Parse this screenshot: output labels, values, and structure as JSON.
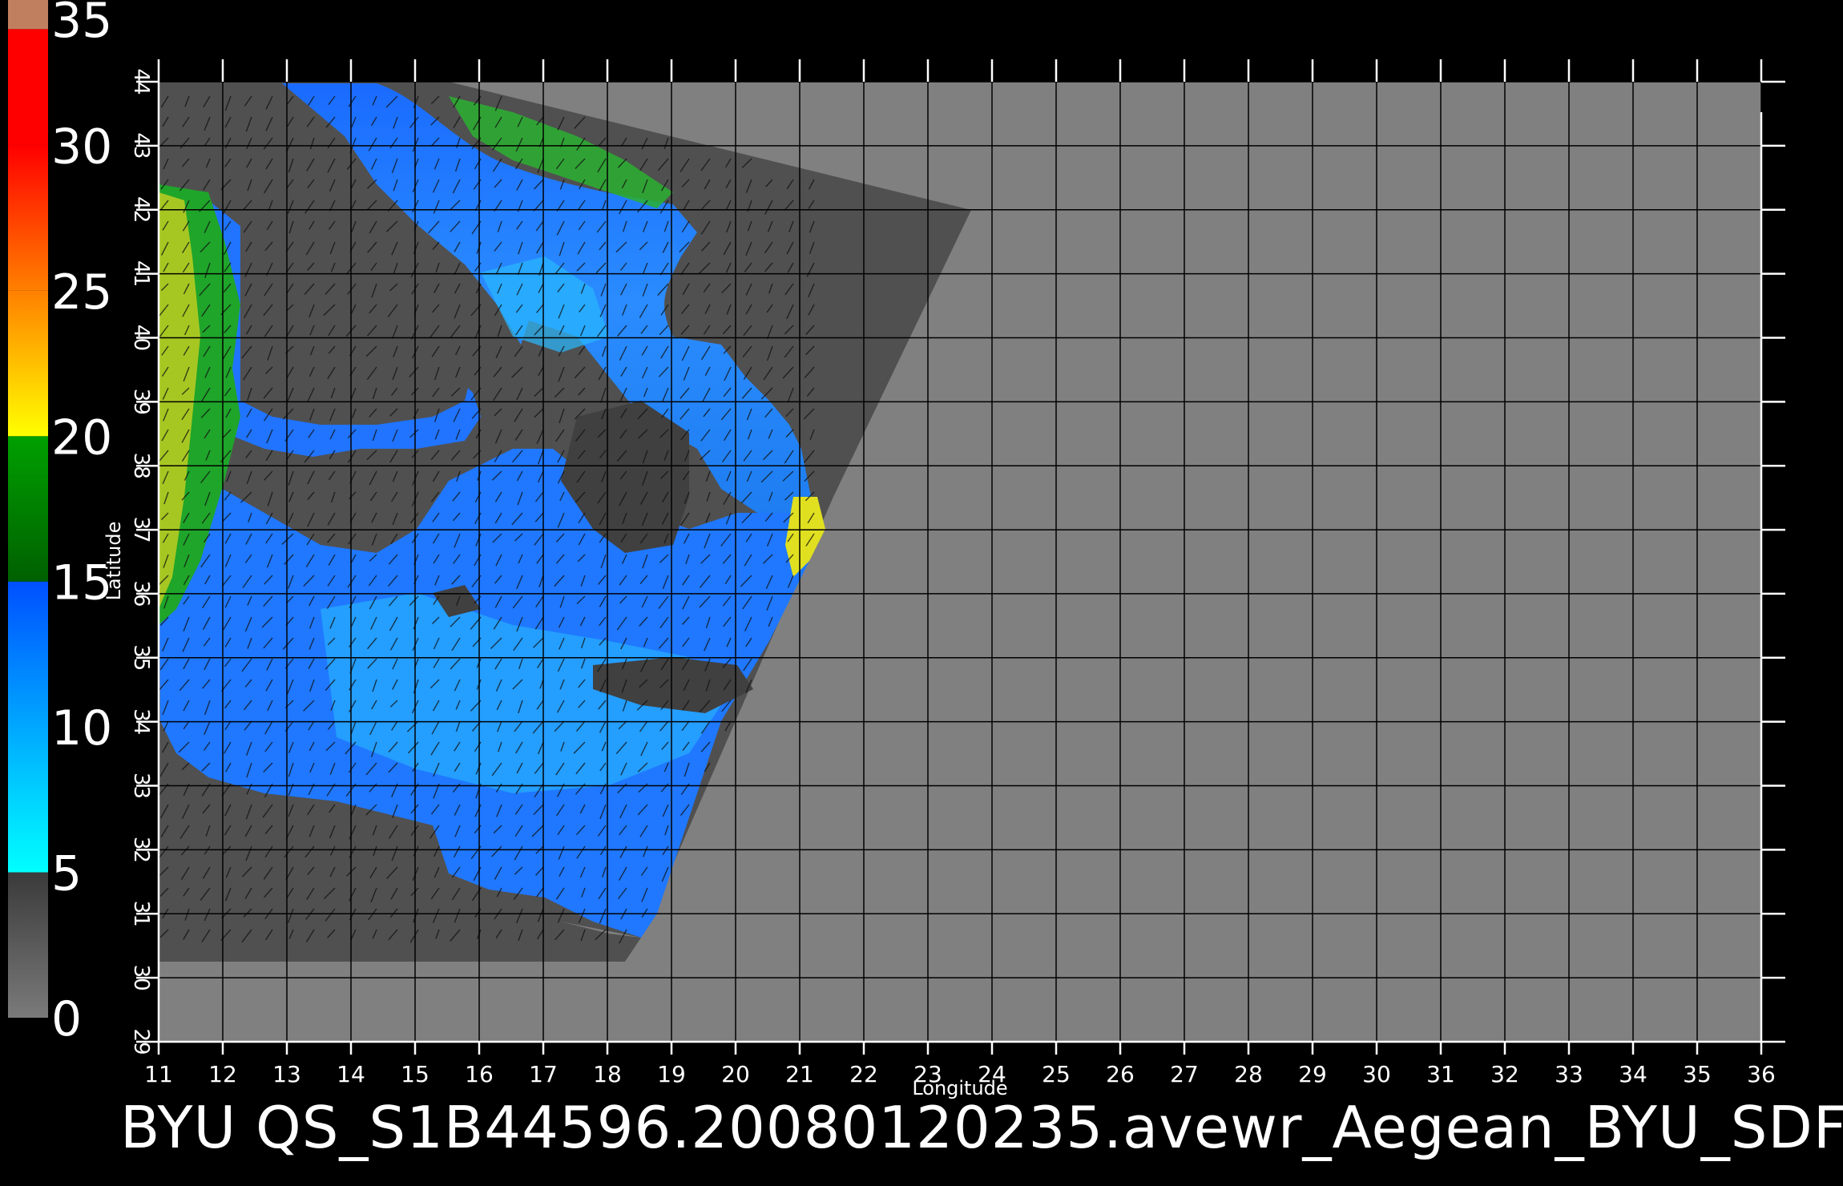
{
  "colorbar": {
    "labels": [
      "35",
      "30",
      "25",
      "20",
      "15",
      "10",
      "5",
      "0"
    ],
    "values": [
      35,
      30,
      25,
      20,
      15,
      10,
      5,
      0
    ],
    "colors": {
      "gray_dark": "#3a3a3a",
      "gray_light": "#7a7a7a",
      "cyan": "#00ffff",
      "blue": "#0050ff",
      "green": "#00a000",
      "yellow": "#ffff00",
      "orange": "#ff8000",
      "red": "#ff0000",
      "tan": "#c08060"
    }
  },
  "map": {
    "lon_ticks": [
      "11",
      "12",
      "13",
      "14",
      "15",
      "16",
      "17",
      "18",
      "19",
      "20",
      "21",
      "22",
      "23",
      "24",
      "25",
      "26",
      "27",
      "28",
      "29",
      "30",
      "31",
      "32",
      "33",
      "34",
      "35",
      "36"
    ],
    "lat_ticks": [
      "29",
      "30",
      "31",
      "32",
      "33",
      "34",
      "35",
      "36",
      "37",
      "38",
      "39",
      "40",
      "41",
      "42",
      "43",
      "44"
    ],
    "lon_range": [
      11,
      36
    ],
    "lat_range": [
      29,
      44
    ],
    "xlabel": "Longitude",
    "ylabel": "Latitude",
    "background_color": "#808080",
    "swath_color": "#505050",
    "land_color": "#505050"
  },
  "caption": "BYU  QS_S1B44596.20080120235.avewr_Aegean_BYU_SDF"
}
